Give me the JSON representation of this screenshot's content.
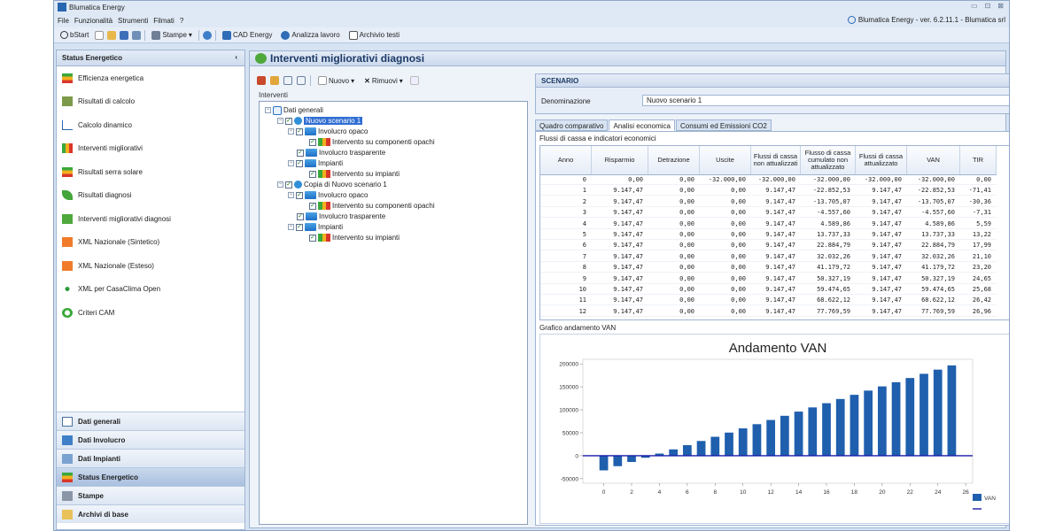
{
  "titlebar": {
    "app_name": "Blumatica Energy",
    "controls": [
      "▭",
      "⊡",
      "⊠"
    ]
  },
  "menu": {
    "items": [
      "File",
      "Funzionalità",
      "Strumenti",
      "Filmati",
      "?"
    ],
    "version": "Blumatica Energy - ver. 6.2.11.1 - Blumatica srl"
  },
  "toolbar": {
    "bstart": "bStart",
    "stampe": "Stampe",
    "cad": "CAD Energy",
    "analizza": "Analizza lavoro",
    "archivio": "Archivio testi"
  },
  "left": {
    "title": "Status Energetico",
    "collapse": "‹",
    "items": [
      {
        "label": "Efficienza energetica",
        "icon": "energy-class-icon"
      },
      {
        "label": "Risultati di calcolo",
        "icon": "results-icon"
      },
      {
        "label": "Calcolo dinamico",
        "icon": "dynamic-chart-icon"
      },
      {
        "label": "Interventi migliorativi",
        "icon": "improvement-icon"
      },
      {
        "label": "Risultati serra solare",
        "icon": "solar-greenhouse-icon"
      },
      {
        "label": "Risultati diagnosi",
        "icon": "leaf-icon"
      },
      {
        "label": "Interventi migliorativi diagnosi",
        "icon": "diagnosis-icon"
      },
      {
        "label": "XML Nazionale (Sintetico)",
        "icon": "xml-icon"
      },
      {
        "label": "XML Nazionale (Esteso)",
        "icon": "xml-icon"
      },
      {
        "label": "XML per CasaClima Open",
        "icon": "casaclima-icon"
      },
      {
        "label": "Criteri CAM",
        "icon": "recycle-icon"
      }
    ],
    "nav": [
      "Dati generali",
      "Dati Involucro",
      "Dati Impianti",
      "Status Energetico",
      "Stampe",
      "Archivi di base"
    ],
    "nav_active": "Status Energetico"
  },
  "main": {
    "title": "Interventi migliorativi diagnosi",
    "tree_tools": {
      "nuovo": "Nuovo",
      "rimuovi": "Rimuovi"
    },
    "tree_label": "Interventi",
    "tree": {
      "root": "Dati generali",
      "scenario1": "Nuovo scenario 1",
      "scenario2": "Copia di Nuovo scenario 1",
      "opaco": "Involucro opaco",
      "opaco_int": "Intervento su componenti opachi",
      "trasp": "Involucro trasparente",
      "impianti": "Impianti",
      "impianti_int": "Intervento su impianti"
    },
    "scenario": {
      "head": "SCENARIO",
      "label": "Denominazione",
      "value": "Nuovo scenario 1"
    },
    "tabs": [
      "Quadro comparativo",
      "Analisi economica",
      "Consumi ed Emissioni CO2"
    ],
    "active_tab": "Analisi economica",
    "grid_title": "Flussi di cassa e indicatori economici",
    "columns": [
      "Anno",
      "Risparmio",
      "Detrazione",
      "Uscite",
      "Flussi di cassa non attualizzati",
      "Flusso di cassa cumulato non attualizzato",
      "Flussi di cassa attualizzato",
      "VAN",
      "TIR"
    ],
    "rows": [
      [
        "0",
        "0,00",
        "0,00",
        "-32.000,00",
        "-32.000,00",
        "-32.000,00",
        "-32.000,00",
        "-32.000,00",
        "0,00"
      ],
      [
        "1",
        "9.147,47",
        "0,00",
        "0,00",
        "9.147,47",
        "-22.852,53",
        "9.147,47",
        "-22.852,53",
        "-71,41"
      ],
      [
        "2",
        "9.147,47",
        "0,00",
        "0,00",
        "9.147,47",
        "-13.705,07",
        "9.147,47",
        "-13.705,07",
        "-30,36"
      ],
      [
        "3",
        "9.147,47",
        "0,00",
        "0,00",
        "9.147,47",
        "-4.557,60",
        "9.147,47",
        "-4.557,60",
        "-7,31"
      ],
      [
        "4",
        "9.147,47",
        "0,00",
        "0,00",
        "9.147,47",
        "4.589,86",
        "9.147,47",
        "4.589,86",
        "5,59"
      ],
      [
        "5",
        "9.147,47",
        "0,00",
        "0,00",
        "9.147,47",
        "13.737,33",
        "9.147,47",
        "13.737,33",
        "13,22"
      ],
      [
        "6",
        "9.147,47",
        "0,00",
        "0,00",
        "9.147,47",
        "22.884,79",
        "9.147,47",
        "22.884,79",
        "17,99"
      ],
      [
        "7",
        "9.147,47",
        "0,00",
        "0,00",
        "9.147,47",
        "32.032,26",
        "9.147,47",
        "32.032,26",
        "21,10"
      ],
      [
        "8",
        "9.147,47",
        "0,00",
        "0,00",
        "9.147,47",
        "41.179,72",
        "9.147,47",
        "41.179,72",
        "23,20"
      ],
      [
        "9",
        "9.147,47",
        "0,00",
        "0,00",
        "9.147,47",
        "50.327,19",
        "9.147,47",
        "50.327,19",
        "24,65"
      ],
      [
        "10",
        "9.147,47",
        "0,00",
        "0,00",
        "9.147,47",
        "59.474,65",
        "9.147,47",
        "59.474,65",
        "25,68"
      ],
      [
        "11",
        "9.147,47",
        "0,00",
        "0,00",
        "9.147,47",
        "68.622,12",
        "9.147,47",
        "68.622,12",
        "26,42"
      ],
      [
        "12",
        "9.147,47",
        "0,00",
        "0,00",
        "9.147,47",
        "77.769,59",
        "9.147,47",
        "77.769,59",
        "26,96"
      ]
    ],
    "chart_label": "Grafico andamento VAN"
  },
  "chart_data": {
    "type": "bar",
    "title": "Andamento VAN",
    "x": [
      0,
      1,
      2,
      3,
      4,
      5,
      6,
      7,
      8,
      9,
      10,
      11,
      12,
      13,
      14,
      15,
      16,
      17,
      18,
      19,
      20,
      21,
      22,
      23,
      24,
      25
    ],
    "series": [
      {
        "name": "VAN",
        "values": [
          -32000,
          -22852.53,
          -13705.07,
          -4557.6,
          4589.86,
          13737.33,
          22884.79,
          32032.26,
          41179.72,
          50327.19,
          59474.65,
          68622.12,
          77769.59,
          86917,
          96064,
          105212,
          114359,
          123507,
          132654,
          141801,
          150949,
          160096,
          169244,
          178391,
          187539,
          196686
        ]
      }
    ],
    "xticks": [
      0,
      2,
      4,
      6,
      8,
      10,
      12,
      14,
      16,
      18,
      20,
      22,
      24,
      26
    ],
    "yticks": [
      -50000,
      0,
      50000,
      100000,
      150000,
      200000
    ],
    "xlim": [
      -1.5,
      26.5
    ],
    "ylim": [
      -60000,
      210000
    ],
    "legend_position": "bottom-right",
    "colors": {
      "bar": "#1f5fad",
      "baseline": "#1a1aa8"
    }
  }
}
